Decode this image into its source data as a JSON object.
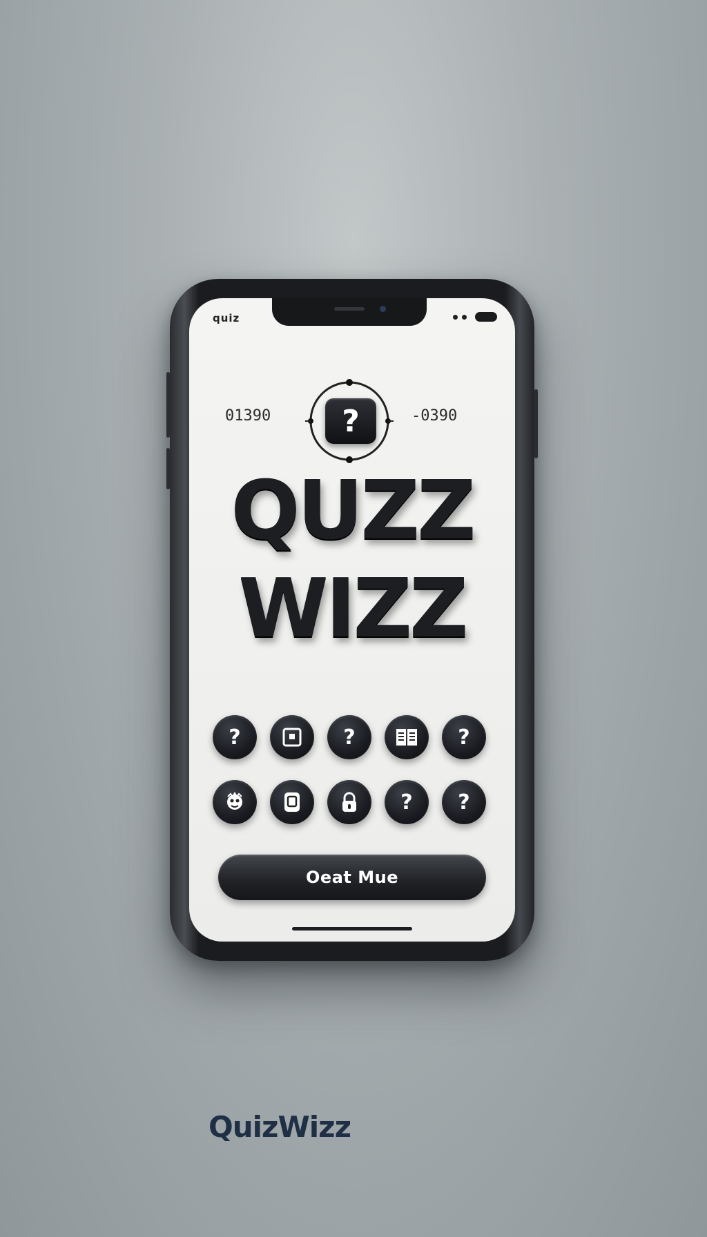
{
  "background": {
    "blurred_left": "",
    "blurred_right": "",
    "color": "#a9b0b2"
  },
  "status_bar": {
    "left_text": "quiz",
    "right_icons": [
      "signal-dots-icon",
      "battery-icon"
    ]
  },
  "timer": {
    "left_value": "01390",
    "right_value": "-0390",
    "center_icon": "question-mark-icon",
    "center_glyph": "?"
  },
  "title": {
    "line1": "QUZZ",
    "line2": "WIZZ"
  },
  "icons": [
    {
      "name": "question-mark-icon",
      "glyph": "?"
    },
    {
      "name": "flag-icon",
      "glyph": ""
    },
    {
      "name": "question-mark-icon",
      "glyph": "?"
    },
    {
      "name": "book-icon",
      "glyph": ""
    },
    {
      "name": "question-mark-icon",
      "glyph": "?"
    },
    {
      "name": "character-icon",
      "glyph": ""
    },
    {
      "name": "document-icon",
      "glyph": ""
    },
    {
      "name": "lock-icon",
      "glyph": ""
    },
    {
      "name": "question-mark-icon",
      "glyph": "?"
    },
    {
      "name": "question-mark-icon",
      "glyph": "?"
    }
  ],
  "cta": {
    "label": "Oeat Mue"
  },
  "brand": {
    "name": "QuizWizz",
    "color": "#1f2f45"
  },
  "colors": {
    "phone_frame": "#1b1c1f",
    "screen_bg": "#f4f4f2",
    "title_text": "#1c1e22",
    "button_bg": "#222428"
  }
}
